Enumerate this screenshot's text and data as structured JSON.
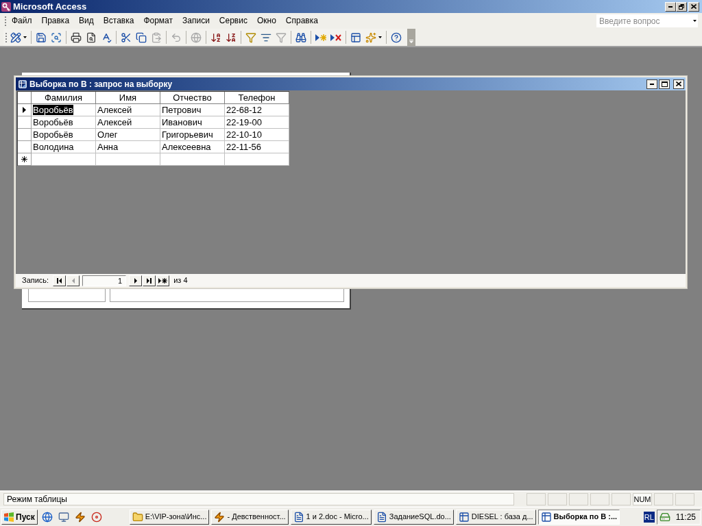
{
  "app_window": {
    "title": "Microsoft Access"
  },
  "menu_bar": {
    "items": [
      "Файл",
      "Правка",
      "Вид",
      "Вставка",
      "Формат",
      "Записи",
      "Сервис",
      "Окно",
      "Справка"
    ],
    "help_box": {
      "placeholder": "Введите вопрос"
    }
  },
  "toolbar": {
    "groups": [
      [
        {
          "kind": "view",
          "dropdown": true,
          "disabled": false
        }
      ],
      [
        {
          "kind": "save",
          "dropdown": false,
          "disabled": false
        },
        {
          "kind": "file_search",
          "dropdown": false,
          "disabled": false
        }
      ],
      [
        {
          "kind": "print",
          "dropdown": false,
          "disabled": false
        },
        {
          "kind": "print_preview",
          "dropdown": false,
          "disabled": false
        },
        {
          "kind": "spelling",
          "dropdown": false,
          "disabled": false
        }
      ],
      [
        {
          "kind": "cut",
          "dropdown": false,
          "disabled": false
        },
        {
          "kind": "copy",
          "dropdown": false,
          "disabled": false
        },
        {
          "kind": "paste",
          "dropdown": false,
          "disabled": true
        }
      ],
      [
        {
          "kind": "undo",
          "dropdown": false,
          "disabled": true
        }
      ],
      [
        {
          "kind": "hyperlink",
          "dropdown": false,
          "disabled": true
        }
      ],
      [
        {
          "kind": "sort_ascending",
          "dropdown": false,
          "disabled": false
        },
        {
          "kind": "sort_descending",
          "dropdown": false,
          "disabled": false
        }
      ],
      [
        {
          "kind": "filter_by_selection",
          "dropdown": false,
          "disabled": false
        },
        {
          "kind": "filter_by_form",
          "dropdown": false,
          "disabled": false
        },
        {
          "kind": "apply_filter",
          "dropdown": false,
          "disabled": true
        }
      ],
      [
        {
          "kind": "find",
          "dropdown": false,
          "disabled": false
        }
      ],
      [
        {
          "kind": "new_record",
          "dropdown": false,
          "disabled": false
        },
        {
          "kind": "delete_record",
          "dropdown": false,
          "disabled": false
        }
      ],
      [
        {
          "kind": "database_window",
          "dropdown": false,
          "disabled": false
        },
        {
          "kind": "new_object",
          "dropdown": true,
          "disabled": false
        }
      ],
      [
        {
          "kind": "help",
          "dropdown": false,
          "disabled": false
        }
      ]
    ]
  },
  "query_window": {
    "title": "Выборка по В : запрос на выборку",
    "datasheet": {
      "columns": [
        "Фамилия",
        "Имя",
        "Отчество",
        "Телефон"
      ],
      "rows": [
        {
          "selected": true,
          "cells": [
            {
              "text": "Воробьёв",
              "selected": true
            },
            {
              "text": "Алексей",
              "selected": false
            },
            {
              "text": "Петрович",
              "selected": false
            },
            {
              "text": "22-68-12",
              "selected": false
            }
          ]
        },
        {
          "selected": false,
          "cells": [
            {
              "text": "Воробьёв",
              "selected": false
            },
            {
              "text": "Алексей",
              "selected": false
            },
            {
              "text": "Иванович",
              "selected": false
            },
            {
              "text": "22-19-00",
              "selected": false
            }
          ]
        },
        {
          "selected": false,
          "cells": [
            {
              "text": "Воробьёв",
              "selected": false
            },
            {
              "text": "Олег",
              "selected": false
            },
            {
              "text": "Григорьевич",
              "selected": false
            },
            {
              "text": "22-10-10",
              "selected": false
            }
          ]
        },
        {
          "selected": false,
          "cells": [
            {
              "text": "Володина",
              "selected": false
            },
            {
              "text": "Анна",
              "selected": false
            },
            {
              "text": "Алексеевна",
              "selected": false
            },
            {
              "text": "22-11-56",
              "selected": false
            }
          ]
        }
      ],
      "new_record_row": true
    },
    "navigator": {
      "label": "Запись:",
      "back_buttons": [
        {
          "kind": "first",
          "disabled": false
        },
        {
          "kind": "previous",
          "disabled": true
        }
      ],
      "value": "1",
      "forward_buttons": [
        {
          "kind": "next",
          "disabled": false
        },
        {
          "kind": "last",
          "disabled": false
        },
        {
          "kind": "new",
          "disabled": false
        }
      ],
      "total": "из 4"
    }
  },
  "status_bar": {
    "message": "Режим таблицы",
    "indicators": [
      "NUM"
    ]
  },
  "taskbar": {
    "start_button": "Пуск",
    "tasks": [
      {
        "kind": "folder",
        "label": "E:\\VIP-зона\\Инс...",
        "selected": false
      },
      {
        "kind": "player",
        "label": "- Девственност...",
        "selected": false
      },
      {
        "kind": "word",
        "label": "1 и 2.doc - Micro...",
        "selected": false
      },
      {
        "kind": "word",
        "label": "ЗаданиеSQL.do...",
        "selected": false
      },
      {
        "kind": "access",
        "label": "DIESEL : база д...",
        "selected": false
      },
      {
        "kind": "access",
        "label": "Выборка по В :...",
        "selected": true
      }
    ],
    "language": "RL",
    "clock": "11:25"
  }
}
